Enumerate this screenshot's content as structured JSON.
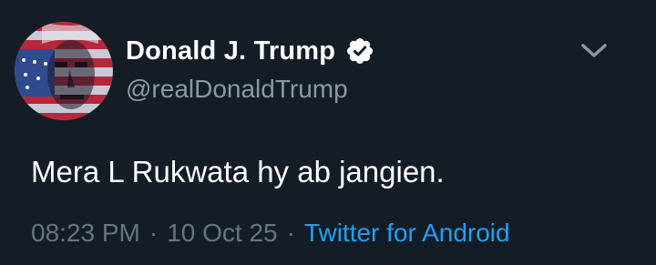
{
  "author": {
    "display_name": "Donald J. Trump",
    "handle": "@realDonaldTrump",
    "verified": true,
    "avatar": "flag-portrait-avatar"
  },
  "tweet": {
    "text": "Mera L Rukwata hy ab jangien."
  },
  "meta": {
    "time": "08:23 PM",
    "separator": "·",
    "date": "10 Oct 25",
    "source": "Twitter for Android"
  },
  "colors": {
    "background": "#141d26",
    "text": "#ffffff",
    "muted": "#8899a6",
    "link": "#1da1f2"
  },
  "icons": {
    "verified": "verified-badge-icon",
    "menu": "chevron-down-icon"
  }
}
